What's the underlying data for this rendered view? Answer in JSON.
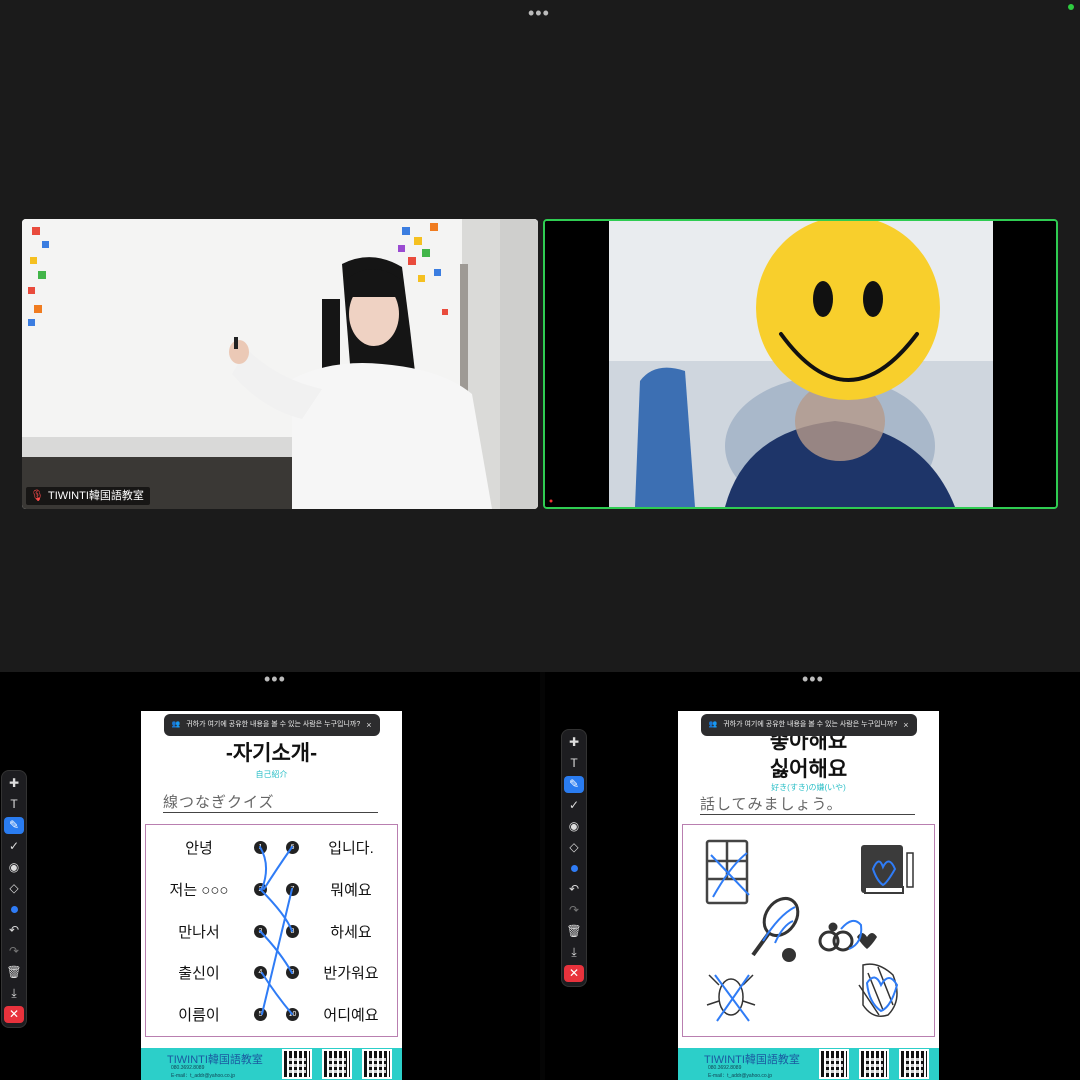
{
  "meeting": {
    "top_menu": "•••",
    "participants": [
      {
        "name": "TIWINTI韓国語教室",
        "muted": true
      },
      {
        "name": "",
        "muted": false
      }
    ]
  },
  "share_left": {
    "menu": "•••",
    "notice": "귀하가 여기에 공유한 내용을 볼 수 있는 사람은 누구입니까?",
    "notice_close": "×",
    "title": "-자기소개-",
    "subtitle": "自己紹介",
    "task": "線つなぎクイズ",
    "left_words": [
      "안녕",
      "저는 ○○○",
      "만나서",
      "출신이",
      "이름이"
    ],
    "left_nums": [
      "1",
      "2",
      "3",
      "4",
      "5"
    ],
    "right_nums": [
      "6",
      "7",
      "8",
      "9",
      "10"
    ],
    "right_words": [
      "입니다.",
      "뭐예요",
      "하세요",
      "반가워요",
      "어디예요"
    ],
    "footer_brand": "TIWINTI韓国語教室",
    "footer_phone": "080.3692.8089",
    "footer_mail": "E-mail：t_addr@yahoo.co.jp"
  },
  "share_right": {
    "menu": "•••",
    "notice": "귀하가 여기에 공유한 내용을 볼 수 있는 사람은 누구입니까?",
    "notice_close": "×",
    "title1": "좋아해요",
    "title2": "싫어해요",
    "subtitle": "好き(すき)の嫌(いや)",
    "task": "話してみましょう。",
    "footer_brand": "TIWINTI韓国語教室",
    "footer_phone": "080.3692.8089",
    "footer_mail": "E-mail：t_addr@yahoo.co.jp"
  },
  "toolbar": {
    "tools": [
      "move-icon",
      "text-icon",
      "pen-icon",
      "check-icon",
      "spotlight-icon",
      "eraser-icon",
      "color-icon",
      "undo-icon",
      "redo-icon",
      "trash-icon",
      "download-icon",
      "close-icon"
    ]
  },
  "colors": {
    "accent": "#2a7cf0",
    "active_speaker": "#2fcc52",
    "close": "#e8323c",
    "footer": "#2ccfc9"
  }
}
